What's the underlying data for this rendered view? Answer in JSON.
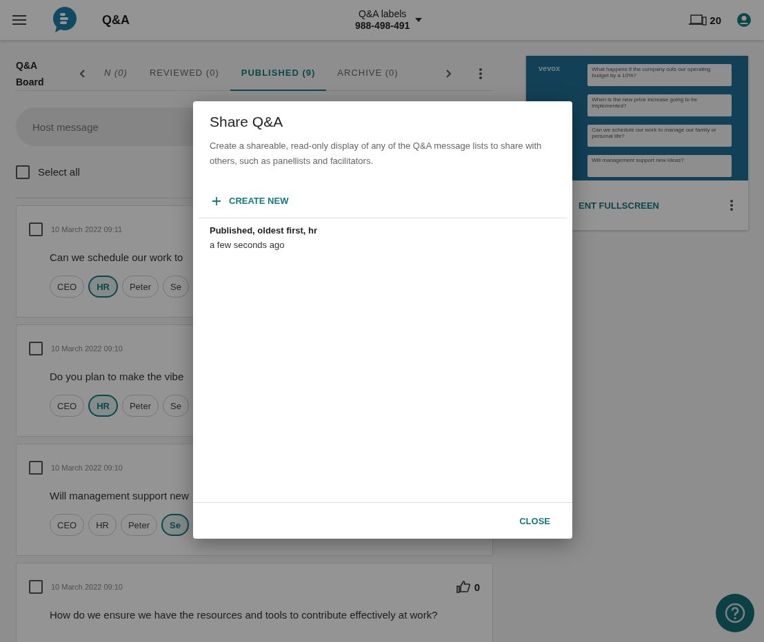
{
  "header": {
    "title": "Q&A",
    "event_name": "Q&A labels",
    "event_code": "988-498-491",
    "participants": "20"
  },
  "board": {
    "title": "Q&A Board",
    "host_placeholder": "Host message",
    "select_all": {
      "label": "Select all",
      "checked": false
    },
    "tabs": [
      {
        "label": "N (0)",
        "selected": false
      },
      {
        "label": "REVIEWED (0)",
        "selected": false
      },
      {
        "label": "PUBLISHED (9)",
        "selected": true
      },
      {
        "label": "ARCHIVE (0)",
        "selected": false
      }
    ]
  },
  "messages": [
    {
      "checked": false,
      "time": "10 March 2022 09:11",
      "text": "Can we schedule our work to",
      "tags": [
        {
          "label": "CEO",
          "selected": false
        },
        {
          "label": "HR",
          "selected": true
        },
        {
          "label": "Peter",
          "selected": false
        },
        {
          "label": "Se",
          "selected": false
        }
      ]
    },
    {
      "checked": false,
      "time": "10 March 2022 09:10",
      "text": "Do you plan to make the vibe",
      "tags": [
        {
          "label": "CEO",
          "selected": false
        },
        {
          "label": "HR",
          "selected": true
        },
        {
          "label": "Peter",
          "selected": false
        },
        {
          "label": "Se",
          "selected": false
        }
      ]
    },
    {
      "checked": false,
      "time": "10 March 2022 09:10",
      "text": "Will management support new",
      "tags": [
        {
          "label": "CEO",
          "selected": false
        },
        {
          "label": "HR",
          "selected": false
        },
        {
          "label": "Peter",
          "selected": false
        },
        {
          "label": "Se",
          "selected": true
        }
      ]
    },
    {
      "checked": false,
      "time": "10 March 2022 09:10",
      "text": "How do we ensure we have the resources and tools to contribute effectively at work?",
      "likes": "0"
    }
  ],
  "preview": {
    "logo": "vevox",
    "questions": [
      "What happens if the company cuts our operating budget by a 10%?",
      "When is the new price increase going to be implemented?",
      "Can we schedule our work to manage our family or personal life?",
      "Will management support new ideas?"
    ],
    "action": "ENT FULLSCREEN"
  },
  "dialog": {
    "title": "Share Q&A",
    "description": "Create a shareable, read-only display of any of the Q&A message lists to share with others, such as panellists and facilitators.",
    "create_label": "CREATE NEW",
    "items": [
      {
        "title": "Published, oldest first, hr",
        "time": "a few seconds ago"
      }
    ],
    "close_label": "CLOSE"
  }
}
